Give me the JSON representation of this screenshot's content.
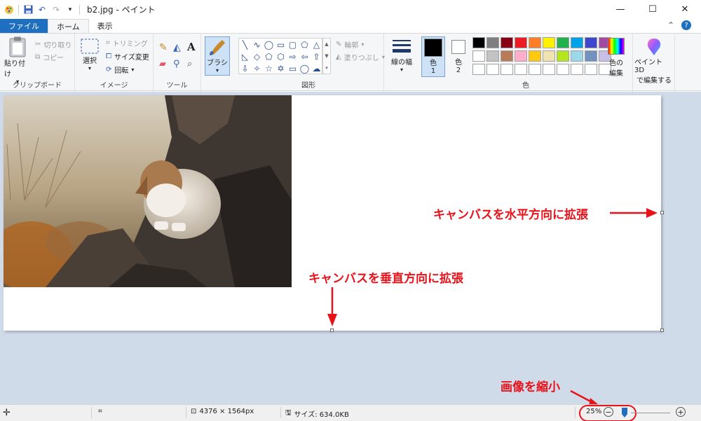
{
  "window": {
    "title": "b2.jpg - ペイント",
    "minimize": "—",
    "maximize": "☐",
    "close": "✕"
  },
  "tabs": [
    {
      "label": "ファイル"
    },
    {
      "label": "ホーム"
    },
    {
      "label": "表示"
    }
  ],
  "ribbon": {
    "clipboard": {
      "paste": "貼り付け",
      "cut": "切り取り",
      "copy": "コピー",
      "group": "クリップボード"
    },
    "image": {
      "select": "選択",
      "crop": "トリミング",
      "resize": "サイズ変更",
      "rotate": "回転",
      "group": "イメージ"
    },
    "tools": {
      "group": "ツール"
    },
    "brushes": {
      "label": "ブラシ"
    },
    "shapes": {
      "outline": "輪郭",
      "fill": "塗りつぶし",
      "group": "図形"
    },
    "size": {
      "label": "線の幅"
    },
    "colors": {
      "color1": "色\n1",
      "color1_a": "色",
      "color1_b": "1",
      "color2_a": "色",
      "color2_b": "2",
      "edit": "色の\n編集",
      "edit_a": "色の",
      "edit_b": "編集",
      "group": "色",
      "paint3d_a": "ペイント 3D",
      "paint3d_b": "で編集する",
      "swatches": [
        "#000000",
        "#7f7f7f",
        "#880015",
        "#ed1c24",
        "#ff7f27",
        "#fff200",
        "#22b14c",
        "#00a2e8",
        "#3f48cc",
        "#a349a4",
        "#ffffff",
        "#c3c3c3",
        "#b97a57",
        "#ffaec9",
        "#ffc90e",
        "#efe4b0",
        "#b5e61d",
        "#99d9ea",
        "#7092be",
        "#c8bfe7",
        "#ffffff",
        "#ffffff",
        "#ffffff",
        "#ffffff",
        "#ffffff",
        "#ffffff",
        "#ffffff",
        "#ffffff",
        "#ffffff",
        "#ffffff"
      ]
    }
  },
  "annotations": {
    "horizontal": "キャンバスを水平方向に拡張",
    "vertical": "キャンバスを垂直方向に拡張",
    "shrink": "画像を縮小"
  },
  "status": {
    "dimensions": "4376 × 1564px",
    "size": "サイズ: 634.0KB",
    "zoom": "25%"
  }
}
